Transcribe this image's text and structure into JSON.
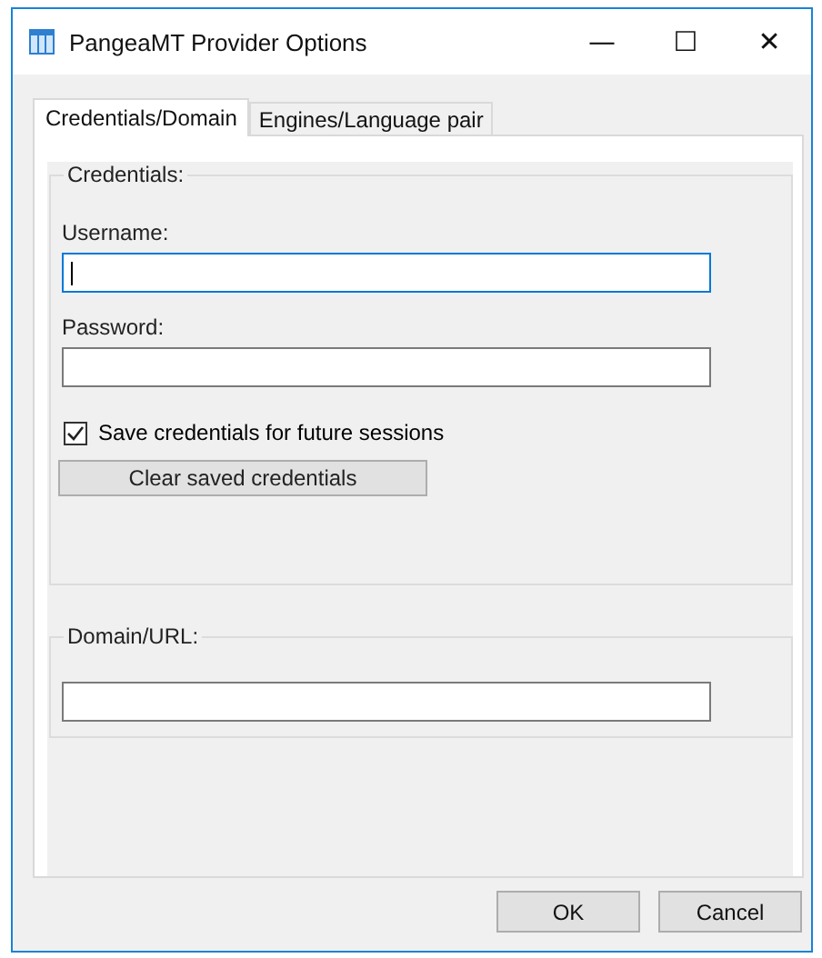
{
  "window": {
    "title": "PangeaMT Provider Options",
    "controls": [
      "—",
      "☐",
      "✕"
    ]
  },
  "tabs": [
    {
      "label": "Credentials/Domain",
      "selected": true
    },
    {
      "label": "Engines/Language pair",
      "selected": false
    }
  ],
  "groups": [
    {
      "title": "Credentials:",
      "items": [
        {
          "kind": "field",
          "label": "Username:",
          "focused": true
        },
        {
          "kind": "field",
          "label": "Password:",
          "focused": false
        },
        {
          "kind": "checkbox",
          "label": "Save credentials for future sessions",
          "checked": true
        },
        {
          "kind": "button",
          "label": "Clear saved credentials"
        }
      ]
    },
    {
      "title": "Domain/URL:",
      "items": [
        {
          "kind": "field",
          "focused": false
        }
      ]
    }
  ],
  "buttons": [
    "OK",
    "Cancel"
  ]
}
